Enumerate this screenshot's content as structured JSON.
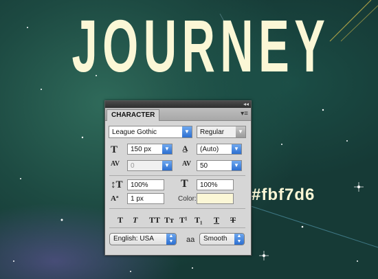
{
  "poster": {
    "title": "JOURNEY",
    "hex_label": "#fbf7d6",
    "text_color": "#fbf7d6"
  },
  "panel": {
    "tab_label": "CHARACTER",
    "font_family": "League Gothic",
    "font_style": "Regular",
    "font_size": "150 px",
    "leading": "(Auto)",
    "kerning": "0",
    "tracking": "50",
    "vertical_scale": "100%",
    "horizontal_scale": "100%",
    "baseline_shift": "1 px",
    "color_label": "Color:",
    "color_value": "#fbf7d6",
    "language": "English: USA",
    "antialias_icon_text": "aa",
    "antialias": "Smooth",
    "style_buttons": [
      "T",
      "T",
      "TT",
      "Tт",
      "T¹",
      "T₁",
      "T",
      "T"
    ]
  }
}
